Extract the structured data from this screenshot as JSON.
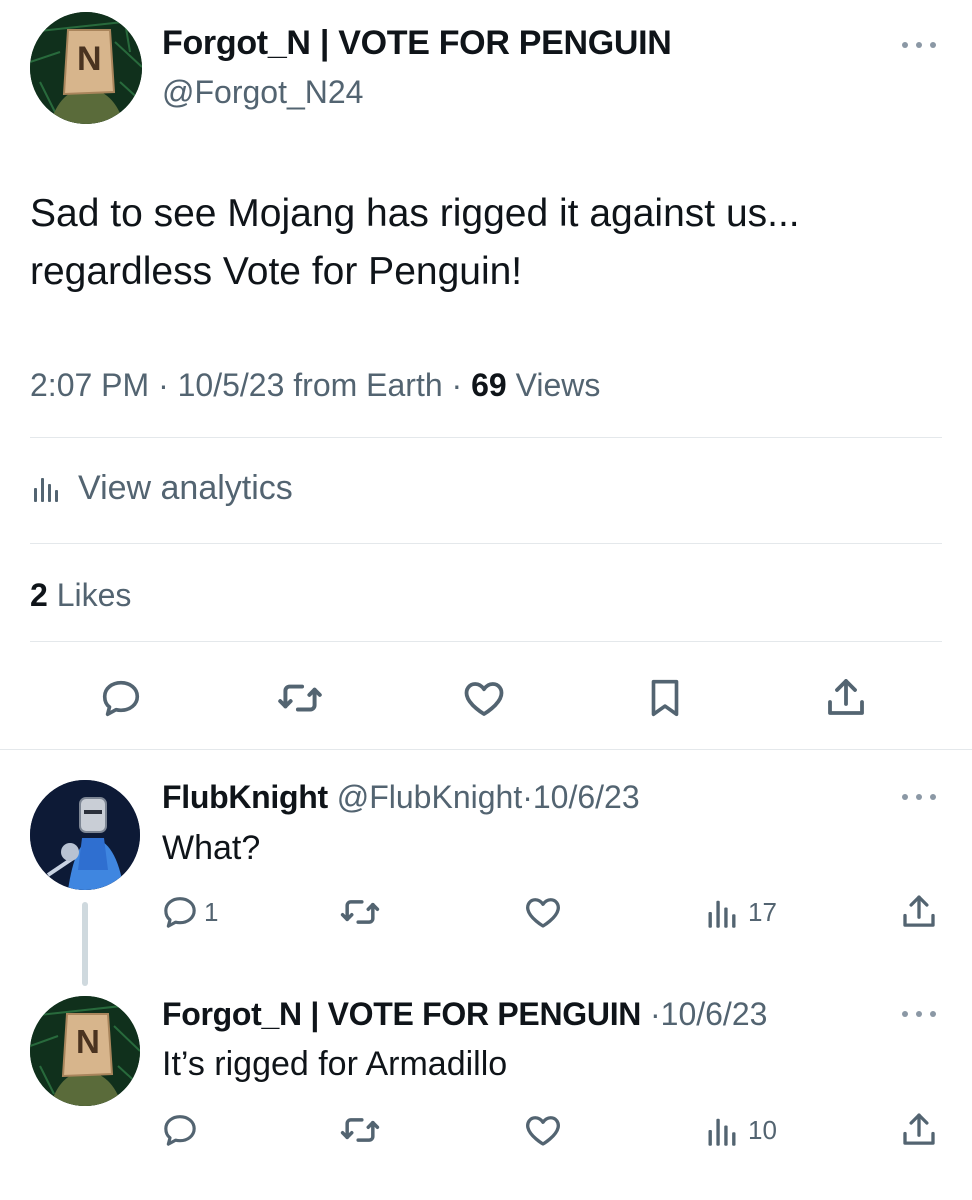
{
  "main_tweet": {
    "display_name": "Forgot_N | VOTE FOR PENGUIN",
    "handle": "@Forgot_N24",
    "avatar_letter": "N",
    "text_line1": "Sad to see Mojang has rigged it against us...",
    "text_line2": "regardless Vote for Penguin!",
    "time": "2:07 PM",
    "date": "10/5/23",
    "source": "from Earth",
    "views_count": "69",
    "views_label": "Views",
    "separator": "·",
    "analytics_label": "View analytics",
    "likes_count": "2",
    "likes_label": "Likes",
    "actions": [
      "reply-icon",
      "retweet-icon",
      "like-icon",
      "bookmark-icon",
      "share-icon"
    ]
  },
  "replies": [
    {
      "display_name": "FlubKnight",
      "handle": "@FlubKnight",
      "date": "10/6/23",
      "text": "What?",
      "reply_count": "1",
      "retweet_count": "",
      "like_count": "",
      "views_count": "17"
    },
    {
      "display_name": "Forgot_N | VOTE FOR PENGUIN",
      "handle": "",
      "date": "10/6/23",
      "text": "It’s rigged for Armadillo",
      "reply_count": "",
      "retweet_count": "",
      "like_count": "",
      "views_count": "10"
    }
  ],
  "colors": {
    "text": "#0f1419",
    "muted": "#536471",
    "divider": "#e4e8eb",
    "thread_line": "#cfd9de"
  }
}
